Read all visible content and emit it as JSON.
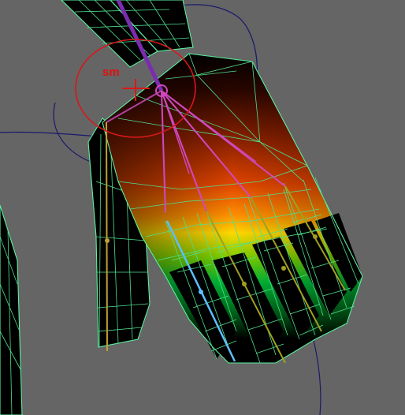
{
  "viewport": {
    "background": "#656565",
    "wireframe_color": "#5cf0a0",
    "gizmo_color": "#d81818",
    "curve_color": "#1a1a6a"
  },
  "gizmo": {
    "label": "sm"
  },
  "weight_gradient": [
    "#000000",
    "#6a1600",
    "#d84000",
    "#ff8a00",
    "#ffe000",
    "#7cd800",
    "#00c040",
    "#000000"
  ],
  "bones": {
    "wrist_color": "#7a2db0",
    "finger_bone_color": "#d048c0",
    "thumb_color": "#c0a030",
    "index_color": "#5cc0ff",
    "ring_color": "#a0a020"
  }
}
